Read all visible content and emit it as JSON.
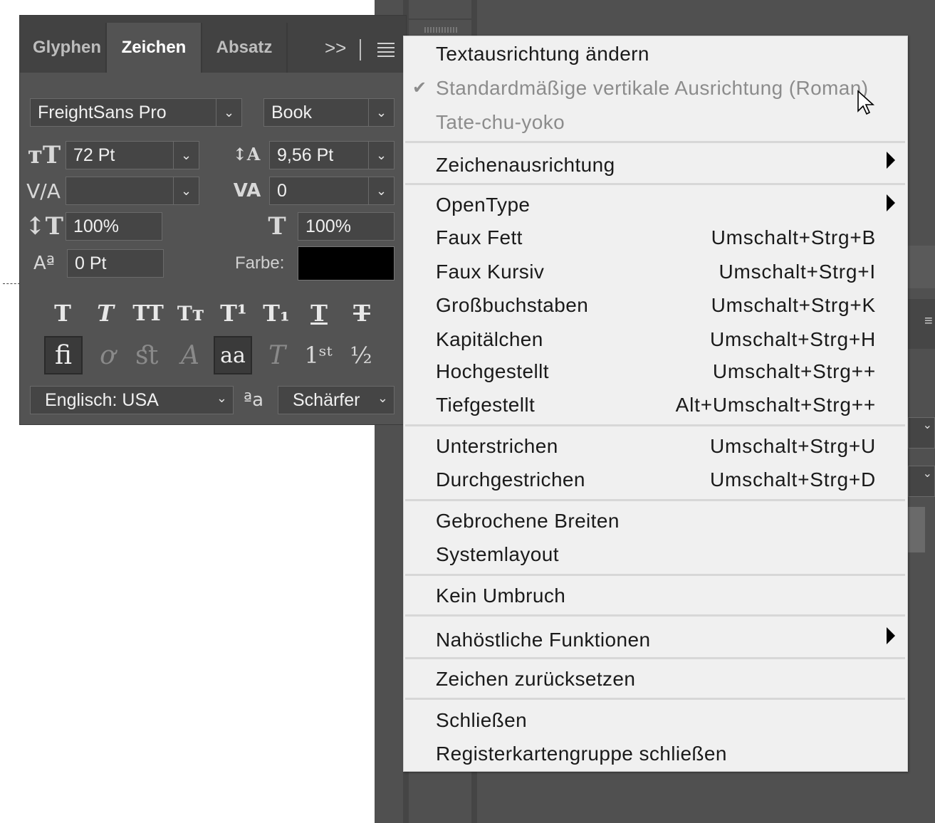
{
  "panel": {
    "tabs": [
      "Glyphen",
      "Zeichen",
      "Absatz"
    ],
    "font_family": "FreightSans Pro",
    "font_style": "Book",
    "font_size": "72 Pt",
    "leading": "9,56 Pt",
    "kerning": "",
    "tracking": "0",
    "vertical_scale": "100%",
    "horizontal_scale": "100%",
    "baseline_shift": "0 Pt",
    "color_label": "Farbe:",
    "color_value": "#000000",
    "language": "Englisch: USA",
    "antialias": "Schärfer"
  },
  "menu": {
    "items": {
      "text_orientation": "Textausrichtung ändern",
      "standard_vertical": "Standardmäßige vertikale Ausrichtung (Roman)",
      "tate_chu_yoko": "Tate-chu-yoko",
      "char_alignment": "Zeichenausrichtung",
      "opentype": "OpenType",
      "faux_bold": "Faux Fett",
      "faux_italic": "Faux Kursiv",
      "all_caps": "Großbuchstaben",
      "small_caps": "Kapitälchen",
      "superscript": "Hochgestellt",
      "subscript": "Tiefgestellt",
      "underline": "Unterstrichen",
      "strikethrough": "Durchgestrichen",
      "fractional_widths": "Gebrochene Breiten",
      "system_layout": "Systemlayout",
      "no_break": "Kein Umbruch",
      "middle_eastern": "Nahöstliche Funktionen",
      "reset_character": "Zeichen zurücksetzen",
      "close": "Schließen",
      "close_tab_group": "Registerkartengruppe schließen"
    },
    "shortcuts": {
      "faux_bold": "Umschalt+Strg+B",
      "faux_italic": "Umschalt+Strg+I",
      "all_caps": "Umschalt+Strg+K",
      "small_caps": "Umschalt+Strg+H",
      "superscript": "Umschalt+Strg++",
      "subscript": "Alt+Umschalt+Strg++",
      "underline": "Umschalt+Strg+U",
      "strikethrough": "Umschalt+Strg+D"
    },
    "checked_item": "standard_vertical"
  },
  "icons": {
    "panel_more": "double-chevron-icon",
    "panel_menu": "hamburger-icon",
    "checkmark": "checkmark-icon",
    "submenu": "triangle-right-icon",
    "cursor": "mouse-pointer-icon"
  }
}
